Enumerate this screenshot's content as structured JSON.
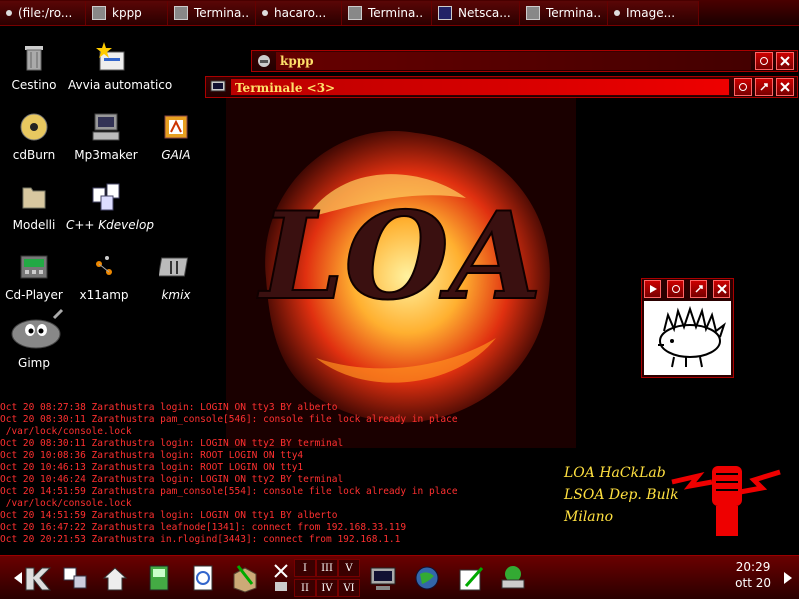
{
  "taskbar": {
    "tasks": [
      {
        "label": "(file:/ro...",
        "icon": "file-icon"
      },
      {
        "label": "kppp",
        "icon": "kppp-icon"
      },
      {
        "label": "Termina..",
        "icon": "terminal-icon"
      },
      {
        "label": "hacaro...",
        "icon": "dot-icon"
      },
      {
        "label": "Termina..",
        "icon": "terminal-icon"
      },
      {
        "label": "Netsca...",
        "icon": "netscape-icon"
      },
      {
        "label": "Termina..",
        "icon": "terminal-icon"
      },
      {
        "label": "Image...",
        "icon": "dot-icon"
      }
    ]
  },
  "desktop": {
    "icons": [
      {
        "label": "Cestino",
        "icon": "trash-icon",
        "italic": false
      },
      {
        "label": "Avvia automatico",
        "icon": "autostart-icon",
        "italic": false
      },
      {
        "label": "cdBurn",
        "icon": "cd-burn-icon",
        "italic": false
      },
      {
        "label": "Mp3maker",
        "icon": "computer-icon",
        "italic": false
      },
      {
        "label": "GAIA",
        "icon": "gaia-icon",
        "italic": true
      },
      {
        "label": "Modelli",
        "icon": "folder-icon",
        "italic": false
      },
      {
        "label": "C++ Kdevelop",
        "icon": "kdevelop-icon",
        "italic": true
      },
      {
        "label": "Cd-Player",
        "icon": "cd-player-icon",
        "italic": false
      },
      {
        "label": "x11amp",
        "icon": "x11amp-icon",
        "italic": false
      },
      {
        "label": "kmix",
        "icon": "kmix-icon",
        "italic": true
      },
      {
        "label": "Gimp",
        "icon": "gimp-icon",
        "italic": false
      }
    ]
  },
  "windows": {
    "kppp_title": "kppp",
    "terminal_title": "Terminale <3>"
  },
  "console": {
    "lines": [
      "Oct 20 08:27:38 Zarathustra login: LOGIN ON tty3 BY alberto",
      "Oct 20 08:30:11 Zarathustra pam_console[546]: console file lock already in place",
      " /var/lock/console.lock",
      "Oct 20 08:30:11 Zarathustra login: LOGIN ON tty2 BY terminal",
      "Oct 20 10:08:36 Zarathustra login: ROOT LOGIN ON tty4",
      "Oct 20 10:46:13 Zarathustra login: ROOT LOGIN ON tty1",
      "Oct 20 10:46:24 Zarathustra login: LOGIN ON tty2 BY terminal",
      "Oct 20 14:51:59 Zarathustra pam_console[554]: console file lock already in place",
      " /var/lock/console.lock",
      "Oct 20 14:51:59 Zarathustra login: LOGIN ON tty1 BY alberto",
      "Oct 20 16:47:22 Zarathustra leafnode[1341]: connect from 192.168.33.119",
      "Oct 20 20:21:53 Zarathustra in.rlogind[3443]: connect from 192.168.1.1"
    ]
  },
  "logo": {
    "art_text": "LOA",
    "lines": [
      "LOA HaCkLab",
      "LSOA Dep. Bulk",
      "Milano"
    ]
  },
  "panel": {
    "desktops": [
      "I",
      "III",
      "V",
      "II",
      "IV",
      "VI"
    ],
    "time": "20:29",
    "date": "ott 20"
  },
  "colors": {
    "accent": "#cc0000",
    "console_text": "#ff3030",
    "logo_text": "#ffe040"
  }
}
